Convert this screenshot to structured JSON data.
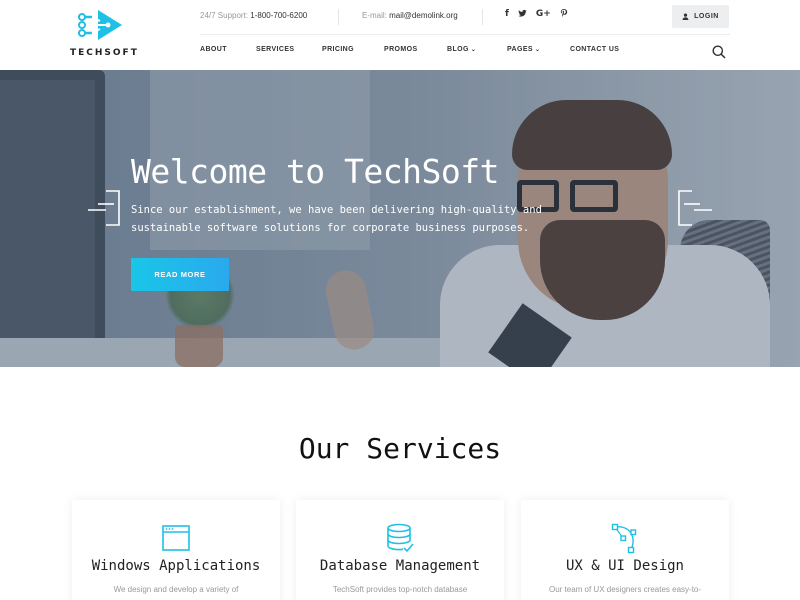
{
  "brand": {
    "name": "TECHSOFT",
    "accent": "#1fc0e6"
  },
  "topbar": {
    "support_label": "24/7 Support:",
    "support_phone": "1-800-700-6200",
    "email_label": "E-mail:",
    "email_value": "mail@demolink.org",
    "social": [
      {
        "icon": "facebook-icon",
        "glyph": "f"
      },
      {
        "icon": "twitter-icon",
        "glyph": "🐦"
      },
      {
        "icon": "google-plus-icon",
        "glyph": "G+"
      },
      {
        "icon": "pinterest-icon",
        "glyph": "℗"
      }
    ],
    "login_label": "LOGIN"
  },
  "nav": {
    "items": [
      {
        "label": "ABOUT",
        "has_dropdown": false
      },
      {
        "label": "SERVICES",
        "has_dropdown": false
      },
      {
        "label": "PRICING",
        "has_dropdown": false
      },
      {
        "label": "PROMOS",
        "has_dropdown": false
      },
      {
        "label": "BLOG",
        "has_dropdown": true
      },
      {
        "label": "PAGES",
        "has_dropdown": true
      },
      {
        "label": "CONTACT US",
        "has_dropdown": false
      }
    ],
    "caret": "⌄"
  },
  "hero": {
    "title": "Welcome to TechSoft",
    "text": "Since our establishment, we have been delivering high-quality and sustainable software solutions for corporate business purposes.",
    "cta_label": "READ MORE",
    "cta_gradient": [
      "#19c6e8",
      "#2aa9ee"
    ]
  },
  "services": {
    "title": "Our Services",
    "cards": [
      {
        "icon": "window-app-icon",
        "title": "Windows Applications",
        "text": "We design and develop a variety of"
      },
      {
        "icon": "database-icon",
        "title": "Database Management",
        "text": "TechSoft provides top-notch database"
      },
      {
        "icon": "vector-pen-icon",
        "title": "UX & UI Design",
        "text": "Our team of UX designers creates easy-to-"
      }
    ]
  }
}
